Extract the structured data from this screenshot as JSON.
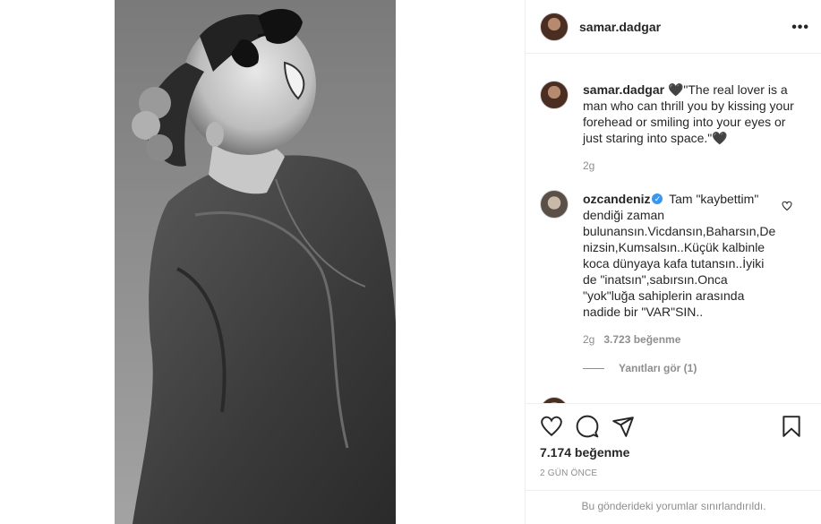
{
  "post": {
    "author": "samar.dadgar"
  },
  "header": {
    "username": "samar.dadgar",
    "more_icon": "more-horizontal-icon"
  },
  "caption": {
    "username": "samar.dadgar",
    "text": "🖤\"The real lover is a man who can thrill you by kissing your forehead or smiling into your eyes or just staring into space.\"🖤",
    "time": "2g"
  },
  "comments": [
    {
      "username": "ozcandeniz",
      "verified": true,
      "text": "Tam \"kaybettim\" dendiği zaman bulunansın.Vicdansın,Baharsın,De nizsin,Kumsalsın..Küçük kalbinle koca dünyaya kafa tutansın..İyiki de \"inatsın\",sabırsın.Onca \"yok\"luğa sahiplerin arasında nadide bir \"VAR\"SIN..",
      "time": "2g",
      "likes": "3.723 beğenme",
      "replies": "Yanıtları gör (1)"
    }
  ],
  "actions": {
    "like_icon": "heart-icon",
    "comment_icon": "comment-icon",
    "share_icon": "send-icon",
    "save_icon": "bookmark-icon"
  },
  "likes": "7.174 beğenme",
  "date": "2 GÜN ÖNCE",
  "comments_limited": "Bu gönderideki yorumlar sınırlandırıldı."
}
